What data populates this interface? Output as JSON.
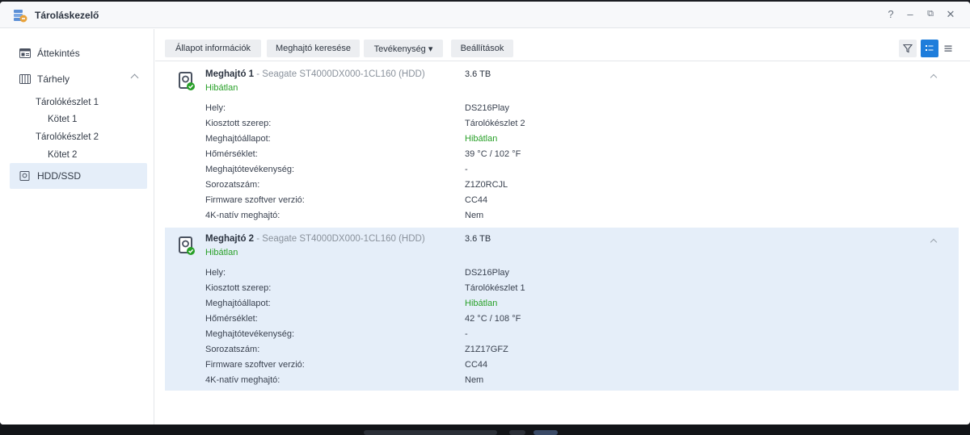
{
  "window": {
    "title": "Tároláskezelő",
    "controls": {
      "help": "?",
      "minimize": "–",
      "restore": "⧉",
      "close": "✕"
    }
  },
  "sidebar": {
    "overview": "Áttekintés",
    "storage": "Tárhely",
    "pool1": "Tárolókészlet 1",
    "vol1": "Kötet 1",
    "pool2": "Tárolókészlet 2",
    "vol2": "Kötet 2",
    "hdd": "HDD/SSD"
  },
  "toolbar": {
    "status_info": "Állapot információk",
    "find_drive": "Meghajtó keresése",
    "activity": "Tevékenység ▾",
    "settings": "Beállítások"
  },
  "labels": {
    "location": "Hely:",
    "allocated_role": "Kiosztott szerep:",
    "drive_status": "Meghajtóállapot:",
    "temperature": "Hőmérséklet:",
    "drive_activity": "Meghajtótevékenység:",
    "serial": "Sorozatszám:",
    "firmware": "Firmware szoftver verzió:",
    "native_4k": "4K-natív meghajtó:"
  },
  "drives": [
    {
      "name": "Meghajtó 1",
      "model": " - Seagate ST4000DX000-1CL160 (HDD)",
      "status": "Hibátlan",
      "size": "3.6 TB",
      "location": "DS216Play",
      "allocated_role": "Tárolókészlet 2",
      "drive_status": "Hibátlan",
      "temperature": "39 °C / 102 °F",
      "drive_activity": "-",
      "serial": "Z1Z0RCJL",
      "firmware": "CC44",
      "native_4k": "Nem"
    },
    {
      "name": "Meghajtó 2",
      "model": " - Seagate ST4000DX000-1CL160 (HDD)",
      "status": "Hibátlan",
      "size": "3.6 TB",
      "location": "DS216Play",
      "allocated_role": "Tárolókészlet 1",
      "drive_status": "Hibátlan",
      "temperature": "42 °C / 108 °F",
      "drive_activity": "-",
      "serial": "Z1Z17GFZ",
      "firmware": "CC44",
      "native_4k": "Nem"
    }
  ],
  "colors": {
    "accent": "#1e7ddb",
    "good": "#28a028",
    "selected": "#e5eef9"
  }
}
